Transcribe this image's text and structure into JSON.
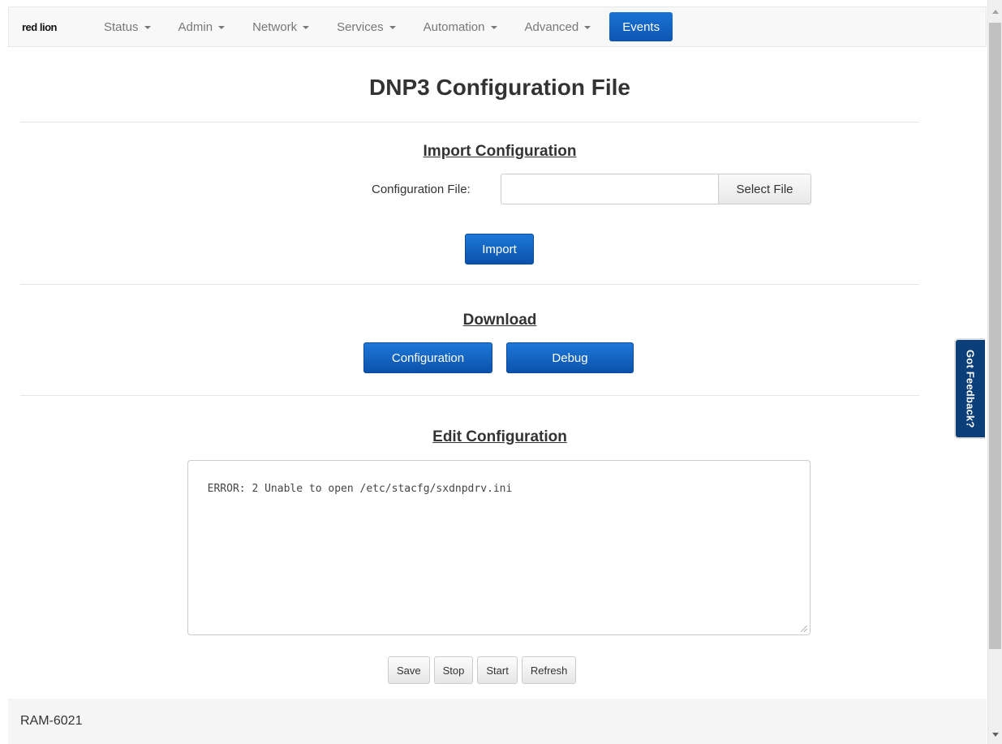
{
  "navbar": {
    "logo_text": "red lion",
    "items": [
      {
        "label": "Status"
      },
      {
        "label": "Admin"
      },
      {
        "label": "Network"
      },
      {
        "label": "Services"
      },
      {
        "label": "Automation"
      },
      {
        "label": "Advanced"
      }
    ],
    "events_label": "Events"
  },
  "page": {
    "title": "DNP3 Configuration File"
  },
  "import_section": {
    "title": "Import Configuration",
    "file_label": "Configuration File:",
    "file_value": "",
    "select_file_label": "Select File",
    "import_label": "Import"
  },
  "download_section": {
    "title": "Download",
    "configuration_label": "Configuration",
    "debug_label": "Debug"
  },
  "edit_section": {
    "title": "Edit Configuration",
    "content": "ERROR: 2 Unable to open /etc/stacfg/sxdnpdrv.ini",
    "buttons": {
      "save": "Save",
      "stop": "Stop",
      "start": "Start",
      "refresh": "Refresh"
    }
  },
  "feedback_label": "Got Feedback?",
  "footer": {
    "model": "RAM-6021"
  },
  "colors": {
    "primary_button": "#0d5bb5",
    "events_tab": "#1565c0",
    "feedback_tab": "#0b3f7a"
  }
}
